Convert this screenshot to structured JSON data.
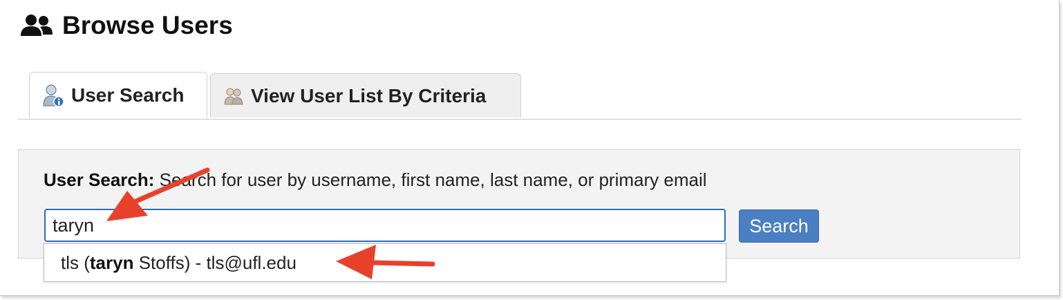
{
  "page": {
    "title": "Browse Users",
    "title_icon": "users-group-icon"
  },
  "tabs": [
    {
      "label": "User Search",
      "icon": "user-info-icon",
      "active": true
    },
    {
      "label": "View User List By Criteria",
      "icon": "users-list-icon",
      "active": false
    }
  ],
  "search": {
    "label": "User Search:",
    "description": " Search for user by username, first name, last name, or primary email",
    "value": "taryn",
    "button_label": "Search"
  },
  "suggestions": [
    {
      "prefix": "tls (",
      "match": "taryn",
      "suffix": " Stoffs) - tls@ufl.edu"
    }
  ],
  "annotations": {
    "arrow_color": "#e8412b",
    "accent_color": "#4a80c2"
  }
}
